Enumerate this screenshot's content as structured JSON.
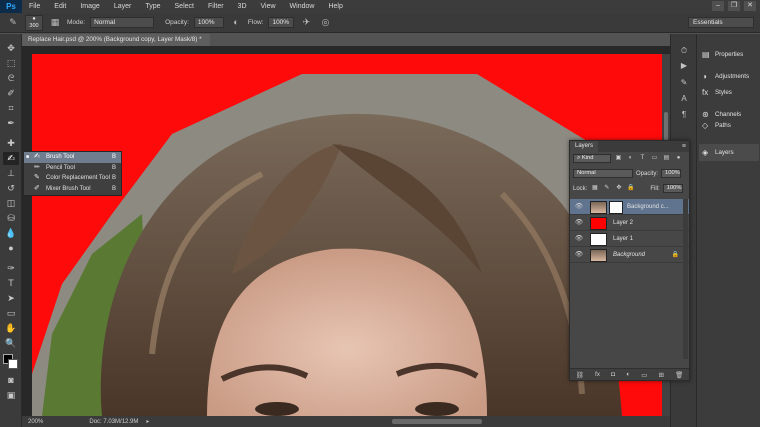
{
  "app": {
    "logo": "Ps"
  },
  "menu": [
    "File",
    "Edit",
    "Image",
    "Layer",
    "Type",
    "Select",
    "Filter",
    "3D",
    "View",
    "Window",
    "Help"
  ],
  "window_controls": [
    "–",
    "❐",
    "✕"
  ],
  "options": {
    "brush_size": "300",
    "mode_label": "Mode:",
    "mode_value": "Normal",
    "opacity_label": "Opacity:",
    "opacity_value": "100%",
    "flow_label": "Flow:",
    "flow_value": "100%",
    "workspace": "Essentials"
  },
  "document": {
    "tab_title": "Replace Hair.psd @ 200% (Background copy, Layer Mask/8) *",
    "zoom": "200%",
    "doc_info": "Doc: 7.03M/12.9M"
  },
  "flyout": {
    "items": [
      {
        "label": "Brush Tool",
        "key": "B",
        "selected": true
      },
      {
        "label": "Pencil Tool",
        "key": "B",
        "selected": false
      },
      {
        "label": "Color Replacement Tool",
        "key": "B",
        "selected": false
      },
      {
        "label": "Mixer Brush Tool",
        "key": "B",
        "selected": false
      }
    ]
  },
  "dock": {
    "items": [
      "Properties",
      "Adjustments",
      "Styles",
      "Channels",
      "Paths"
    ],
    "layers_label": "Layers"
  },
  "layers_panel": {
    "tab": "Layers",
    "kind_label": "Kind",
    "blend_mode": "Normal",
    "opacity_label": "Opacity:",
    "opacity_value": "100%",
    "lock_label": "Lock:",
    "fill_label": "Fill:",
    "fill_value": "100%",
    "layers": [
      {
        "name": "Background c...",
        "thumb": "photo",
        "has_mask": true,
        "selected": true
      },
      {
        "name": "Layer 2",
        "thumb_color": "#ff0000",
        "selected": false
      },
      {
        "name": "Layer 1",
        "thumb_color": "#ffffff",
        "selected": false
      },
      {
        "name": "Background",
        "thumb": "photo",
        "locked": true,
        "selected": false
      }
    ]
  },
  "colors": {
    "canvas_red": "#ff0a0a",
    "selection_blue": "#60748f",
    "foreground": "#000000",
    "background": "#ffffff"
  }
}
